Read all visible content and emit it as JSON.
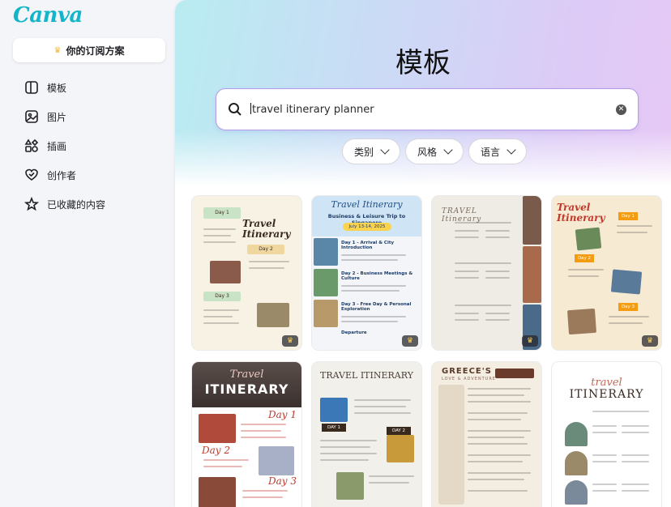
{
  "sidebar": {
    "logo": "Canva",
    "plan_button": "你的订阅方案",
    "items": [
      {
        "label": "模板",
        "icon": "template-icon"
      },
      {
        "label": "图片",
        "icon": "image-icon"
      },
      {
        "label": "插画",
        "icon": "illustration-icon"
      },
      {
        "label": "创作者",
        "icon": "creator-heart-icon"
      },
      {
        "label": "已收藏的内容",
        "icon": "star-icon"
      }
    ]
  },
  "main": {
    "title": "模板",
    "search": {
      "value": "travel itinerary planner"
    },
    "filters": [
      {
        "label": "类别"
      },
      {
        "label": "风格"
      },
      {
        "label": "语言"
      }
    ],
    "templates": [
      {
        "title": "Travel Itinerary",
        "day_labels": [
          "Day 1",
          "Day 2",
          "Day 3"
        ]
      },
      {
        "title": "Travel Itinerary",
        "subtitle": "Business & Leisure Trip to Singapore",
        "date": "July 13-14, 2025",
        "sections": [
          "Day 1 - Arrival & City Introduction",
          "Day 2 - Business Meetings & Culture",
          "Day 3 - Free Day & Personal Exploration",
          "Departure"
        ]
      },
      {
        "title": "TRAVEL Itinerary"
      },
      {
        "title": "Travel Itinerary",
        "day_labels": [
          "Day 1",
          "Day 2",
          "Day 3"
        ]
      },
      {
        "title_script": "Travel",
        "title_main": "ITINERARY",
        "day_labels": [
          "Day 1",
          "Day 2",
          "Day 3"
        ]
      },
      {
        "title": "TRAVEL ITINERARY",
        "day_labels": [
          "DAY 1",
          "DAY 2"
        ]
      },
      {
        "title": "GREECE'S",
        "subtitle": "LOVE & ADVENTURE"
      },
      {
        "title_script": "travel",
        "title_main": "ITINERARY"
      }
    ]
  },
  "colors": {
    "brand": "#12b5c9",
    "search_border": "#b49ae8",
    "crown": "#f4b63e"
  }
}
